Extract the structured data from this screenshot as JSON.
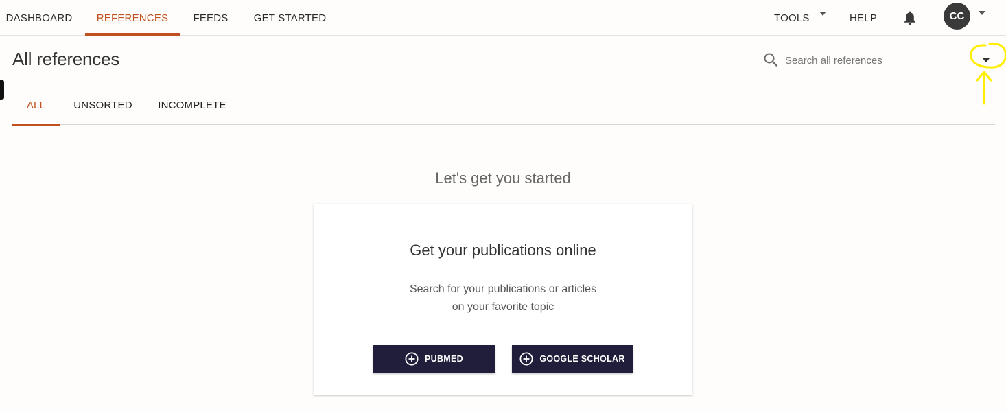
{
  "nav": {
    "items": [
      {
        "label": "DASHBOARD",
        "active": false
      },
      {
        "label": "REFERENCES",
        "active": true
      },
      {
        "label": "FEEDS",
        "active": false
      },
      {
        "label": "GET STARTED",
        "active": false
      }
    ],
    "tools_label": "TOOLS",
    "help_label": "HELP",
    "avatar_initials": "CC"
  },
  "page": {
    "title": "All references"
  },
  "search": {
    "placeholder": "Search all references",
    "value": ""
  },
  "tabs": [
    {
      "label": "ALL",
      "active": true
    },
    {
      "label": "UNSORTED",
      "active": false
    },
    {
      "label": "INCOMPLETE",
      "active": false
    }
  ],
  "empty_state": {
    "heading": "Let's get you started",
    "card_title": "Get your publications online",
    "card_desc_line1": "Search for your publications or articles",
    "card_desc_line2": "on your favorite topic",
    "buttons": [
      {
        "label": "PUBMED",
        "icon": "plus-circle-icon"
      },
      {
        "label": "GOOGLE SCHOLAR",
        "icon": "plus-circle-icon"
      }
    ]
  },
  "annotation": {
    "color": "#ffee00"
  },
  "colors": {
    "accent": "#c0511e",
    "button_bg": "#211e3b",
    "avatar_bg": "#3a3a3a"
  }
}
